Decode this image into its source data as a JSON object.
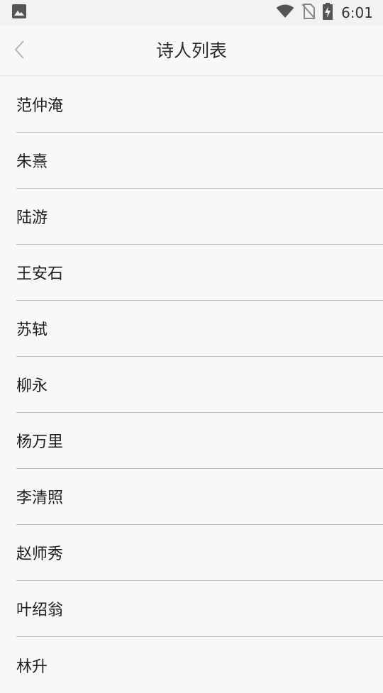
{
  "status_bar": {
    "time": "6:01",
    "icons": [
      "image-icon",
      "wifi-icon",
      "no-sim-icon",
      "battery-charging-icon"
    ]
  },
  "header": {
    "back_icon": "chevron-left-icon",
    "title": "诗人列表"
  },
  "poets": [
    {
      "name": "范仲淹"
    },
    {
      "name": "朱熹"
    },
    {
      "name": "陆游"
    },
    {
      "name": "王安石"
    },
    {
      "name": "苏轼"
    },
    {
      "name": "柳永"
    },
    {
      "name": "杨万里"
    },
    {
      "name": "李清照"
    },
    {
      "name": "赵师秀"
    },
    {
      "name": "叶绍翁"
    },
    {
      "name": "林升"
    }
  ],
  "colors": {
    "background": "#f8f8f8",
    "divider": "#bdbdbd",
    "text": "#1e1e1e"
  }
}
